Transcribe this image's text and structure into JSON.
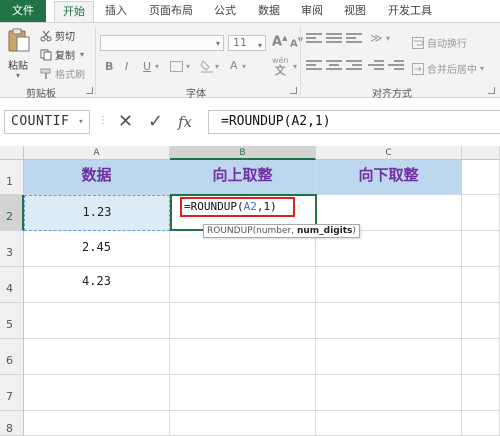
{
  "ribbon": {
    "tabs": [
      "文件",
      "开始",
      "插入",
      "页面布局",
      "公式",
      "数据",
      "审阅",
      "视图",
      "开发工具"
    ],
    "active_tab": "开始",
    "clipboard": {
      "paste_label": "粘贴",
      "cut_label": "剪切",
      "copy_label": "复制",
      "format_painter_label": "格式刷",
      "group_label": "剪贴板"
    },
    "font": {
      "size_value": "11",
      "bold": "B",
      "italic": "I",
      "underline": "U",
      "phonetic": "wén",
      "group_label": "字体"
    },
    "alignment": {
      "wrap_text_label": "自动换行",
      "merge_center_label": "合并后居中",
      "group_label": "对齐方式"
    }
  },
  "formula_bar": {
    "name_box": "COUNTIF",
    "cancel_symbol": "✕",
    "enter_symbol": "✓",
    "fx_symbol": "fx",
    "formula": "=ROUNDUP(A2,1)"
  },
  "sheet": {
    "columns": [
      "A",
      "B",
      "C"
    ],
    "rows": [
      "1",
      "2",
      "3",
      "4",
      "5",
      "6",
      "7",
      "8"
    ],
    "header_row": [
      "数据",
      "向上取整",
      "向下取整"
    ],
    "col_a_values": [
      "1.23",
      "2.45",
      "4.23"
    ],
    "edit": {
      "prefix": "=ROUNDUP(",
      "ref": "A2",
      "suffix": ",1)"
    },
    "tooltip": {
      "func_prefix": "ROUNDUP(number, ",
      "bold_arg": "num_digits",
      "suffix": ")"
    },
    "colors": {
      "header_fill": "#bdd7ee",
      "header_text": "#7030a0",
      "excel_green": "#217346",
      "edit_highlight": "#e02020"
    }
  }
}
